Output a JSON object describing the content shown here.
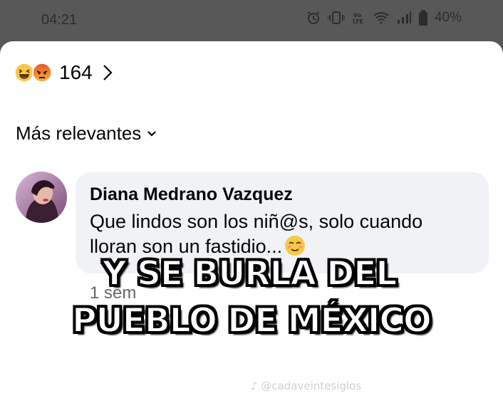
{
  "status_bar": {
    "time": "04:21",
    "battery": "40%",
    "icons": [
      "alarm-icon",
      "vibrate-icon",
      "volte-icon",
      "wifi-icon",
      "signal-icon",
      "battery-icon"
    ]
  },
  "reactions": {
    "emojis": [
      "haha-emoji",
      "angry-emoji"
    ],
    "count": "164"
  },
  "sort": {
    "label": "Más relevantes"
  },
  "comment": {
    "author": "Diana Medrano Vazquez",
    "text": "Que lindos son los niñ@s, solo cuando lloran son un fastidio...",
    "trailing_emoji": "smiling-face-emoji",
    "timestamp": "1 sem"
  },
  "overlay": {
    "line1": "Y SE BURLA DEL",
    "line2": "PUEBLO DE MÉXICO"
  },
  "watermark": "♪ @cadaveintesiglos",
  "colors": {
    "bubble": "#f0f2f5",
    "status_bar": "#585858",
    "secondary_text": "#65676b"
  }
}
